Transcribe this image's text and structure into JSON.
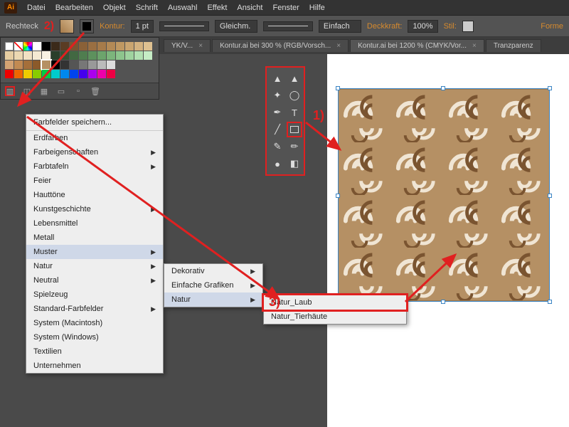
{
  "app": {
    "logo": "Ai"
  },
  "menubar": [
    "Datei",
    "Bearbeiten",
    "Objekt",
    "Schrift",
    "Auswahl",
    "Effekt",
    "Ansicht",
    "Fenster",
    "Hilfe"
  ],
  "control": {
    "tool_name": "Rechteck",
    "kontur_label": "Kontur:",
    "stroke_width": "1 pt",
    "profile": "Gleichm.",
    "brush": "Einfach",
    "opacity_label": "Deckkraft:",
    "opacity": "100%",
    "style_label": "Stil:",
    "form_label": "Forme"
  },
  "tabs": [
    {
      "label": "YK/V..."
    },
    {
      "label": "Kontur.ai bei 300 % (RGB/Vorsch..."
    },
    {
      "label": "Kontur.ai bei 1200 % (CMYK/Vor..."
    },
    {
      "label": "Tranzparenz"
    }
  ],
  "swatch_menu": {
    "header": "Farbfelder speichern...",
    "items": [
      {
        "label": "Erdfarben",
        "sub": false
      },
      {
        "label": "Farbeigenschaften",
        "sub": true
      },
      {
        "label": "Farbtafeln",
        "sub": true
      },
      {
        "label": "Feier",
        "sub": false
      },
      {
        "label": "Hauttöne",
        "sub": false
      },
      {
        "label": "Kunstgeschichte",
        "sub": true
      },
      {
        "label": "Lebensmittel",
        "sub": false
      },
      {
        "label": "Metall",
        "sub": false
      },
      {
        "label": "Muster",
        "sub": true,
        "hi": true
      },
      {
        "label": "Natur",
        "sub": true
      },
      {
        "label": "Neutral",
        "sub": true
      },
      {
        "label": "Spielzeug",
        "sub": false
      },
      {
        "label": "Standard-Farbfelder",
        "sub": true
      },
      {
        "label": "System (Macintosh)",
        "sub": false
      },
      {
        "label": "System (Windows)",
        "sub": false
      },
      {
        "label": "Textilien",
        "sub": false
      },
      {
        "label": "Unternehmen",
        "sub": false
      }
    ]
  },
  "submenu2": [
    {
      "label": "Dekorativ",
      "sub": true
    },
    {
      "label": "Einfache Grafiken",
      "sub": true
    },
    {
      "label": "Natur",
      "sub": true,
      "hi": true
    }
  ],
  "submenu3": [
    {
      "label": "Natur_Laub",
      "boxed": true
    },
    {
      "label": "Natur_Tierhäute"
    }
  ],
  "annotations": {
    "a1": "1)",
    "a2": "2)",
    "a3": "3)"
  }
}
